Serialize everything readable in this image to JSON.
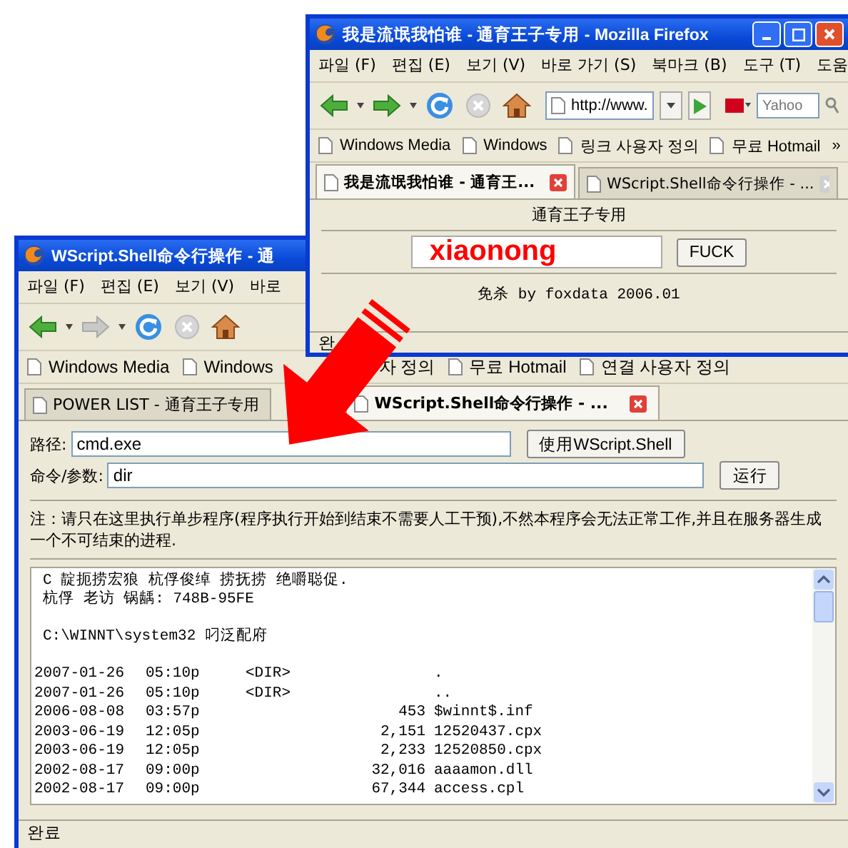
{
  "back_window": {
    "title": "WScript.Shell命令行操作 - 通",
    "menu": [
      "파일 (F)",
      "편집 (E)",
      "보기 (V)",
      "바로"
    ],
    "toolbar": {
      "forward_enabled": false
    },
    "bookmarks": [
      "Windows Media",
      "Windows",
      "자 정의",
      "무료 Hotmail",
      "연결 사용자 정의"
    ],
    "tabs": [
      {
        "label": "POWER LIST - 通育王子专用",
        "selected": false,
        "close_button": false
      },
      {
        "label": "WScript.Shell命令行操作 - ...",
        "selected": true,
        "close_button": true
      }
    ],
    "form": {
      "path_label": "路径:",
      "path_value": "cmd.exe",
      "shell_button": "使用WScript.Shell",
      "command_label": "命令/参数:",
      "command_value": "dir",
      "run_button": "运行",
      "note": "注：请只在这里执行单步程序(程序执行开始到结束不需要人工干预),不然本程序会无法正常工作,并且在服务器生成一个不可结束的进程."
    },
    "output": {
      "volume_info": [
        "C 靛扼捞宏狼 杭俘俊绰 捞抚捞 绝嚼聪促.",
        "杭俘 老访 锅龋: 748B-95FE"
      ],
      "directory": "C:\\WINNT\\system32 叼泛配府",
      "entries": [
        {
          "date": "2007-01-26",
          "time": "05:10p",
          "type": "<DIR>",
          "name": "."
        },
        {
          "date": "2007-01-26",
          "time": "05:10p",
          "type": "<DIR>",
          "name": ".."
        },
        {
          "date": "2006-08-08",
          "time": "03:57p",
          "size": "453",
          "name": "$winnt$.inf"
        },
        {
          "date": "2003-06-19",
          "time": "12:05p",
          "size": "2,151",
          "name": "12520437.cpx"
        },
        {
          "date": "2003-06-19",
          "time": "12:05p",
          "size": "2,233",
          "name": "12520850.cpx"
        },
        {
          "date": "2002-08-17",
          "time": "09:00p",
          "size": "32,016",
          "name": "aaaamon.dll"
        },
        {
          "date": "2002-08-17",
          "time": "09:00p",
          "size": "67,344",
          "name": "access.cpl"
        }
      ]
    },
    "status": "완료"
  },
  "front_window": {
    "title": "我是流氓我怕谁 - 通育王子专用 - Mozilla Firefox",
    "menu": [
      "파일 (F)",
      "편집 (E)",
      "보기 (V)",
      "바로 가기 (S)",
      "북마크 (B)",
      "도구 (T)",
      "도움"
    ],
    "toolbar": {
      "forward_enabled": true,
      "url": "http://www.",
      "search_placeholder": "Yahoo"
    },
    "bookmarks": [
      "Windows Media",
      "Windows",
      "링크 사용자 정의",
      "무료 Hotmail"
    ],
    "bookmarks_more": "»",
    "tabs": [
      {
        "label": "我是流氓我怕谁 - 通育王...",
        "selected": true,
        "close_button": true
      },
      {
        "label": "WScript.Shell命令行操作 - ...",
        "selected": false,
        "close_button": true
      }
    ],
    "page": {
      "heading": "通育王子专用",
      "input_value": "xiaonong",
      "button": "FUCK",
      "footer": "免杀 by foxdata 2006.01"
    },
    "status": "완"
  }
}
